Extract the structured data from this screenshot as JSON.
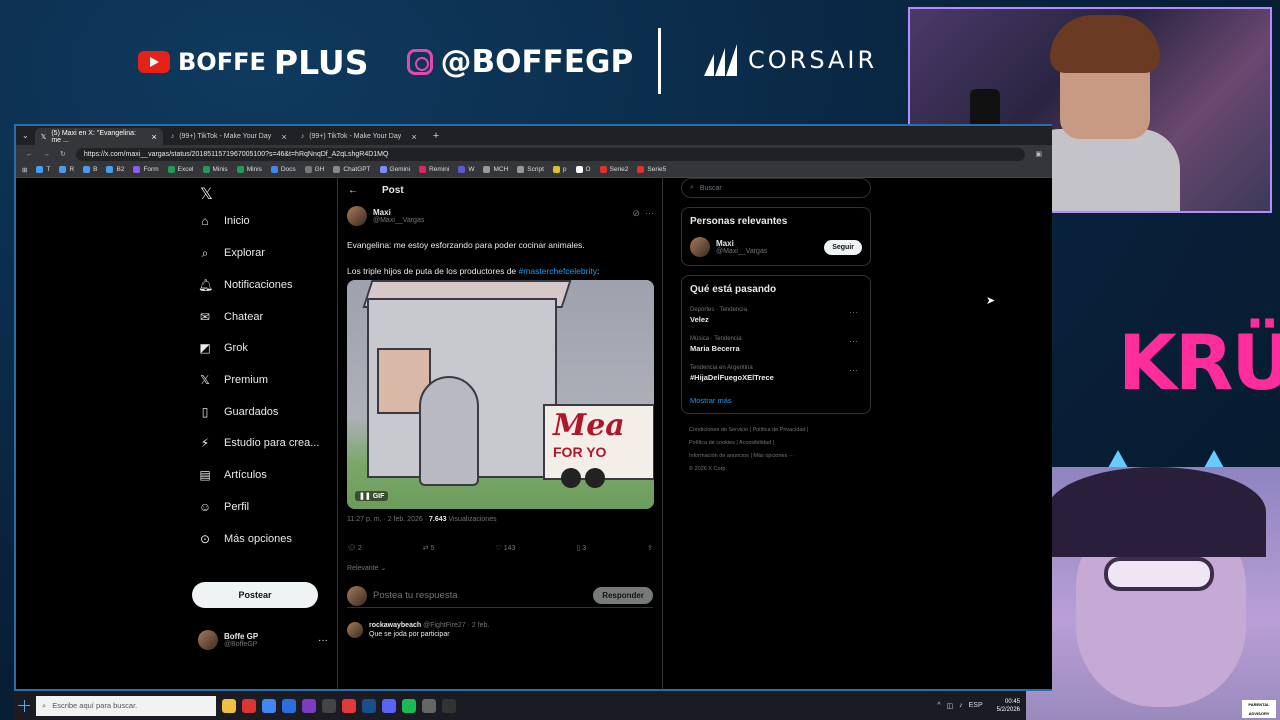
{
  "overlay": {
    "yt_brand": "BOFFE",
    "yt_plus": "PLUS",
    "ig_handle": "@BOFFEGP",
    "sponsor": "CORSAIR",
    "team_logo": "KRÜ",
    "advisory": "PARENTAL ADVISORY EXPLICIT CONTENT"
  },
  "browser": {
    "tabs": [
      {
        "label": "(5) Maxi en X: \"Evangelina: me ..."
      },
      {
        "label": "(99+) TikTok - Make Your Day"
      },
      {
        "label": "(99+) TikTok - Make Your Day"
      }
    ],
    "new_tab": "+",
    "url": "https://x.com/maxi__vargas/status/2018511571967005100?s=46&t=hRqNnqDf_A2qLshgR4D1MQ",
    "bookmarks": [
      "T",
      "R",
      "B",
      "B2",
      "Form",
      "Excel",
      "Minis",
      "Minis",
      "Docs",
      "GH",
      "ChatGPT",
      "Gemini",
      "Remini",
      "W",
      "MCH",
      "Script",
      "p",
      "O",
      "Serie2",
      "Serie5"
    ]
  },
  "nav": {
    "items": [
      {
        "label": "Inicio",
        "icon": "home-icon"
      },
      {
        "label": "Explorar",
        "icon": "search-icon"
      },
      {
        "label": "Notificaciones",
        "icon": "bell-icon"
      },
      {
        "label": "Chatear",
        "icon": "mail-icon"
      },
      {
        "label": "Grok",
        "icon": "grok-icon"
      },
      {
        "label": "Premium",
        "icon": "x-icon"
      },
      {
        "label": "Guardados",
        "icon": "bookmark-icon"
      },
      {
        "label": "Estudio para crea...",
        "icon": "studio-icon"
      },
      {
        "label": "Artículos",
        "icon": "article-icon"
      },
      {
        "label": "Perfil",
        "icon": "user-icon"
      },
      {
        "label": "Más opciones",
        "icon": "more-icon"
      }
    ],
    "post_button": "Postear",
    "me_name": "Boffe GP",
    "me_handle": "@BoffeGP"
  },
  "post": {
    "header": "Post",
    "author_name": "Maxi",
    "author_handle": "@Maxi__Vargas",
    "text_line1": "Evangelina: me estoy esforzando para poder cocinar animales.",
    "text_line2_prefix": "Los triple hijos de puta de los productores de ",
    "text_hashtag": "#masterchefcelebrity",
    "text_line2_suffix": ":",
    "gif_label": "GIF",
    "gif_sign": "Mea",
    "gif_sign2": "FOR YO",
    "time": "11:27 p. m. · 2 feb. 2026 · ",
    "views_count": "7.643",
    "views_label": " Visualizaciones",
    "replies": "2",
    "reposts": "5",
    "likes": "143",
    "bookmarks": "3",
    "sort_label": "Relevante",
    "reply_placeholder": "Postea tu respuesta",
    "reply_button": "Responder",
    "reply_author": "rockawaybeach",
    "reply_meta": "@FightFire27 · 2 feb.",
    "reply_text": "Que se joda por participar"
  },
  "sidebar": {
    "search_placeholder": "Buscar",
    "relevant_title": "Personas relevantes",
    "relevant_name": "Maxi",
    "relevant_handle": "@Maxi__Vargas",
    "follow_label": "Seguir",
    "trends_title": "Qué está pasando",
    "trends": [
      {
        "cat": "Deportes · Tendencia",
        "name": "Velez"
      },
      {
        "cat": "Música · Tendencia",
        "name": "Maria Becerra"
      },
      {
        "cat": "Tendencia en Argentina",
        "name": "#HijaDelFuegoXElTrece"
      }
    ],
    "show_more": "Mostrar más",
    "footer": [
      "Condiciones de Servicio  |  Política de Privacidad  |",
      "Política de cookies  |  Accesibilidad  |",
      "Información de anuncios  |  Más opciones ···",
      "© 2026 X Corp."
    ]
  },
  "taskbar": {
    "search_placeholder": "Escribe aquí para buscar.",
    "lang": "ESP",
    "time": "00:45",
    "date": "5/2/2026"
  },
  "colors": {
    "accent": "#1d9bf0",
    "background_page": "#000000",
    "overlay_bg": "#0a2a46",
    "team_pink": "#ff2d9c"
  }
}
